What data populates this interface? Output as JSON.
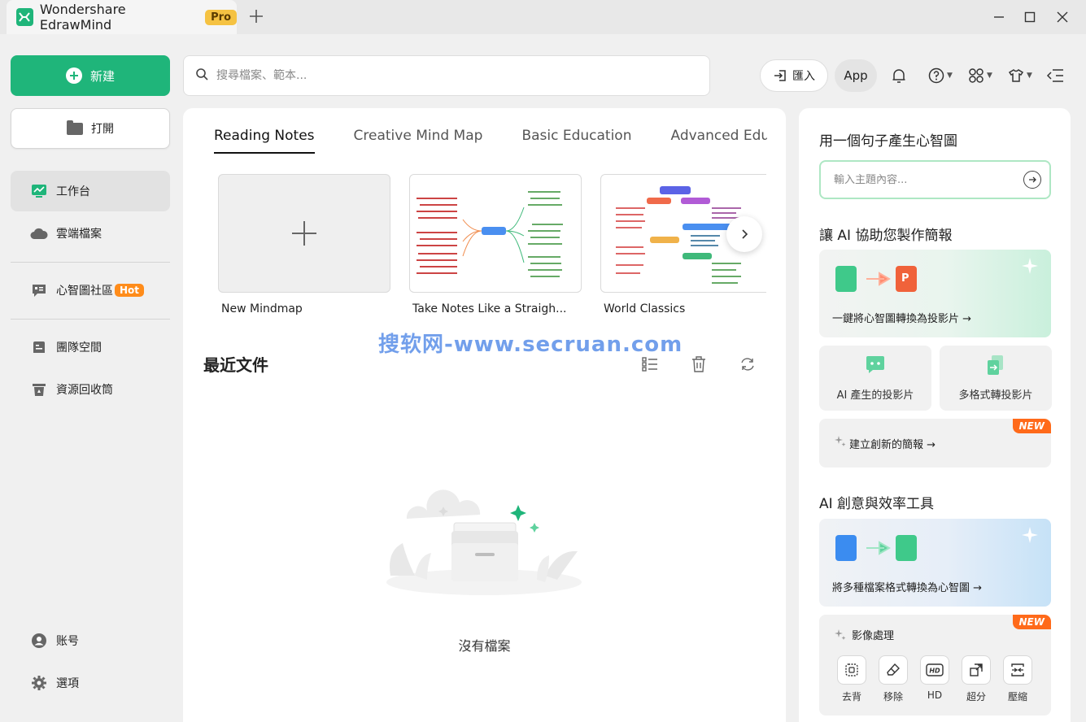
{
  "window": {
    "app_title": "Wondershare EdrawMind",
    "badge": "Pro"
  },
  "sidebar": {
    "new_label": "新建",
    "open_label": "打開",
    "items": [
      {
        "label": "工作台",
        "icon": "workbench-icon",
        "active": true
      },
      {
        "label": "雲端檔案",
        "icon": "cloud-icon"
      },
      {
        "label": "心智圖社區",
        "icon": "community-icon",
        "badge": "Hot"
      },
      {
        "label": "團隊空間",
        "icon": "team-space-icon"
      },
      {
        "label": "資源回收筒",
        "icon": "trash-icon"
      }
    ],
    "bottom": [
      {
        "label": "账号",
        "icon": "account-icon"
      },
      {
        "label": "選項",
        "icon": "gear-icon"
      }
    ]
  },
  "search": {
    "placeholder": "搜尋檔案、範本..."
  },
  "toolbar": {
    "import_label": "匯入",
    "app_label": "App"
  },
  "main": {
    "tabs": [
      {
        "label": "Reading Notes",
        "active": true
      },
      {
        "label": "Creative Mind Map"
      },
      {
        "label": "Basic Education"
      },
      {
        "label": "Advanced Educati"
      }
    ],
    "templates": [
      {
        "label": "New Mindmap"
      },
      {
        "label": "Take Notes Like a Straigh..."
      },
      {
        "label": "World Classics"
      }
    ],
    "watermark": "搜软网-www.secruan.com",
    "recent_title": "最近文件",
    "empty_text": "沒有檔案"
  },
  "right": {
    "generate_title": "用一個句子產生心智圖",
    "topic_placeholder": "輸入主題內容...",
    "ai_ppt_title": "讓 AI 協助您製作簡報",
    "mindmap_to_ppt": "一鍵將心智圖轉換為投影片 →",
    "ai_slides": "AI 產生的投影片",
    "multi_format_slides": "多格式轉投影片",
    "create_presentation": "建立創新的簡報 →",
    "new_badge": "NEW",
    "ai_tools_title": "AI 創意與效率工具",
    "convert_files": "將多種檔案格式轉換為心智圖 →",
    "image_processing": "影像處理",
    "image_tools": [
      {
        "label": "去背",
        "icon": "remove-bg-icon"
      },
      {
        "label": "移除",
        "icon": "eraser-icon"
      },
      {
        "label": "HD",
        "icon": "hd-icon"
      },
      {
        "label": "超分",
        "icon": "upscale-icon"
      },
      {
        "label": "壓縮",
        "icon": "compress-icon"
      }
    ]
  },
  "colors": {
    "brand_green": "#1fb57a",
    "hot_orange": "#ff8c1a",
    "new_orange": "#ff6a1a",
    "pro_yellow": "#f5c242"
  }
}
